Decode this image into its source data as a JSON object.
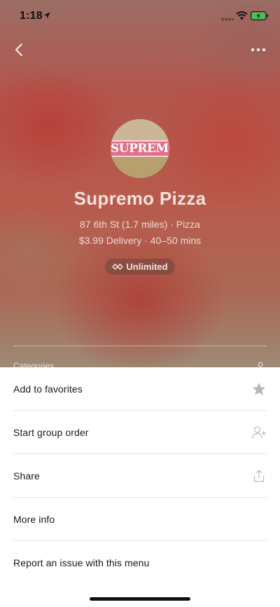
{
  "status_bar": {
    "time": "1:18"
  },
  "header": {
    "logo_text": "SUPREMO",
    "store_name": "Supremo Pizza",
    "address_line": "87 6th St (1.7 miles) · Pizza",
    "delivery_line": "$3.99 Delivery · 40–50 mins",
    "badge_label": "Unlimited",
    "categories_label": "Categories"
  },
  "menu": {
    "items": [
      {
        "label": "Add to favorites",
        "icon": "star-icon"
      },
      {
        "label": "Start group order",
        "icon": "add-person-icon"
      },
      {
        "label": "Share",
        "icon": "share-icon"
      },
      {
        "label": "More info",
        "icon": ""
      },
      {
        "label": "Report an issue with this menu",
        "icon": ""
      }
    ]
  },
  "colors": {
    "text_dark": "#1a1a1a",
    "icon_gray": "#b8b8b8",
    "divider": "#e6e6e6",
    "battery_green": "#34c759"
  }
}
